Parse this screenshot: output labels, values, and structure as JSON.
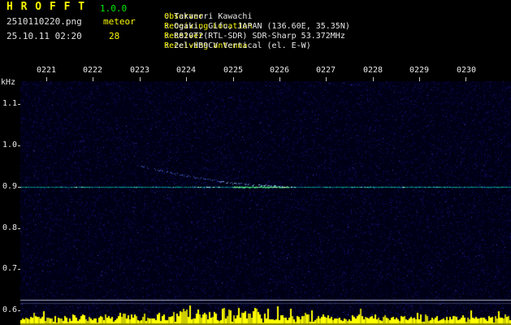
{
  "app": {
    "title": "H R O F F T",
    "version": "1.0.0",
    "filename": "2510110220.png",
    "mode": "meteor",
    "datetime": "25.10.11 02:20",
    "meteor_count": "28"
  },
  "info": {
    "rows": [
      {
        "label": "Observer",
        "value": ": Takanori Kawachi"
      },
      {
        "label": "Receiving Location",
        "value": ": Ogaki, Gifu, JAPAN (136.60E, 35.35N)"
      },
      {
        "label": "Receiver",
        "value": ": R820T2(RTL-SDR) SDR-Sharp 53.372MHz"
      },
      {
        "label": "Receiving antenna",
        "value": ": 2el-HB9CV Vertical (el. E-W)"
      }
    ]
  },
  "colors": {
    "background": "#000000",
    "spectrogram_bg": "#000014",
    "header_yellow": "#f8f800",
    "version_green": "#00e800",
    "text_white": "#e8e8e8",
    "carrier_line": "#00a08a",
    "bright_echo_green": "#7dff9e",
    "doppler_trace_blue": "#4a66c6",
    "noise_bars_yellow": "#ffff00"
  },
  "chart_data": {
    "type": "heatmap",
    "ylabel": "kHz",
    "y_tick_labels": [
      "1.1",
      "1.0",
      "0.9",
      "0.8",
      "0.7",
      "0.6"
    ],
    "y_range_khz": [
      0.55,
      1.15
    ],
    "x_tick_labels": [
      "0221",
      "0222",
      "0223",
      "0224",
      "0225",
      "0226",
      "0227",
      "0228",
      "0229",
      "0230"
    ],
    "x_axis": "time HHMM, 10-minute window starting 02:20",
    "carrier_line_khz": 0.9,
    "meteor_echo_count": 28,
    "doppler_trace": {
      "desc": "faint descending blue trace flattening into the 0.9 kHz carrier line",
      "start_min": 2.95,
      "start_khz": 0.952,
      "end_min": 6.15,
      "end_khz": 0.901
    },
    "bright_echo_segment": {
      "desc": "bright green enhancement on the 0.9 kHz line",
      "start_min": 5.0,
      "end_min": 6.2,
      "khz": 0.9
    },
    "noise_bars_profile": [
      0.35,
      0.3,
      0.45,
      0.8,
      0.95,
      0.55,
      0.4,
      0.35,
      0.3,
      0.3
    ],
    "legend": "bottom yellow bars = received signal level per time bin"
  }
}
